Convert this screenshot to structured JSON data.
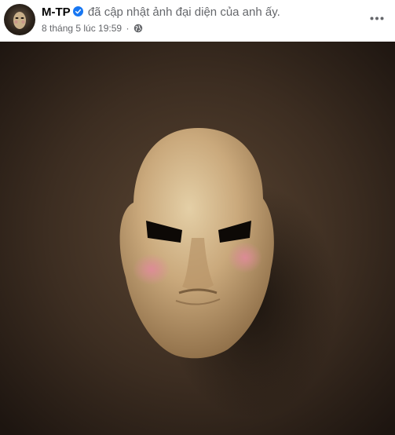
{
  "post": {
    "author": "M-TP",
    "action_text": "đã cập nhật ảnh đại diện của anh ấy.",
    "timestamp": "8 tháng 5 lúc 19:59",
    "separator": "·",
    "privacy_icon": "globe-icon",
    "verified_icon": "verified-badge-icon",
    "more_icon": "more-options-icon",
    "photo_subject": "carved wooden mask on dark brown background"
  },
  "colors": {
    "verified_blue": "#1877f2",
    "secondary_text": "#65676b",
    "primary_text": "#050505"
  }
}
